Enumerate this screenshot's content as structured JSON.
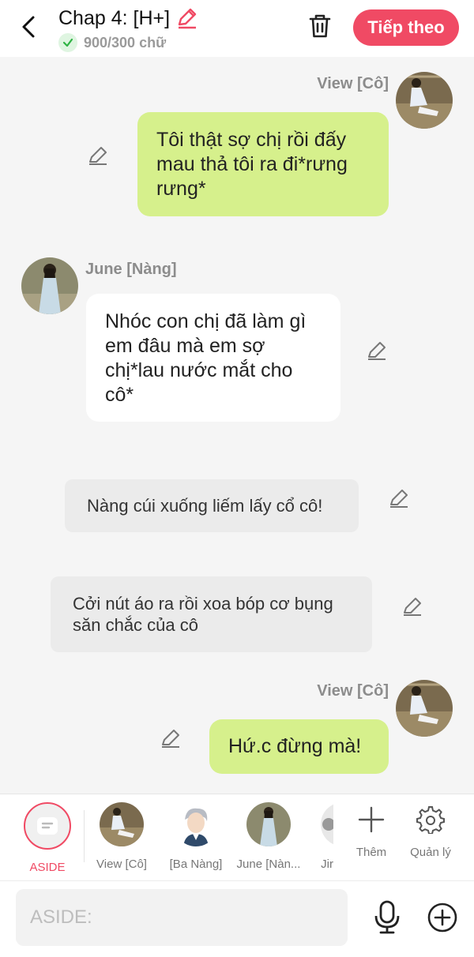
{
  "header": {
    "title": "Chap 4: [H+]",
    "word_count": "900/300 chữ",
    "next_label": "Tiếp theo"
  },
  "messages": [
    {
      "type": "right",
      "sender": "View [Cô]",
      "text": "Tôi thật sợ chị rồi đấy mau thả tôi ra đi*rưng rưng*"
    },
    {
      "type": "left",
      "sender": "June [Nàng]",
      "text": "Nhóc con chị đã làm gì em đâu mà em sợ chị*lau nước mắt cho cô*"
    },
    {
      "type": "narration",
      "text": "Nàng cúi xuống liếm lấy cổ cô!"
    },
    {
      "type": "narration",
      "text": "Cởi nút áo ra rồi xoa bóp cơ bụng săn chắc của cô"
    },
    {
      "type": "right",
      "sender": "View [Cô]",
      "text": "Hứ.c đừng mà!"
    }
  ],
  "characters": [
    {
      "label": "ASIDE"
    },
    {
      "label": "View [Cô]"
    },
    {
      "label": "[Ba Nàng]"
    },
    {
      "label": "June [Nàn..."
    },
    {
      "label": "Jir"
    }
  ],
  "tools": {
    "add_label": "Thêm",
    "manage_label": "Quản lý"
  },
  "input": {
    "placeholder": "ASIDE:"
  },
  "colors": {
    "accent": "#f04a64",
    "bubble_right": "#d6f08c",
    "success": "#2fb344"
  },
  "icons": [
    "back-icon",
    "pen-icon",
    "check-icon",
    "trash-icon",
    "edit-icon",
    "plus-icon",
    "gear-icon",
    "mic-icon",
    "add-circle-icon",
    "aside-icon"
  ]
}
